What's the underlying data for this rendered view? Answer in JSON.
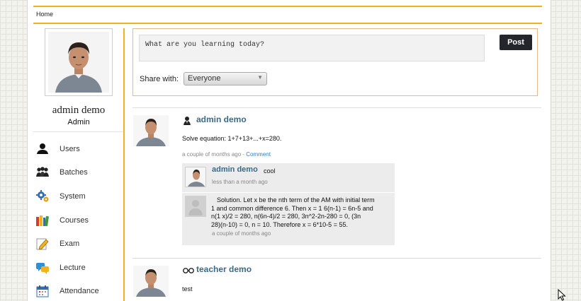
{
  "breadcrumb": {
    "home": "Home"
  },
  "profile": {
    "name": "admin demo",
    "role": "Admin"
  },
  "menu": [
    {
      "label": "Users",
      "icon": "users-icon"
    },
    {
      "label": "Batches",
      "icon": "batches-icon"
    },
    {
      "label": "System",
      "icon": "system-gear-icon"
    },
    {
      "label": "Courses",
      "icon": "courses-books-icon"
    },
    {
      "label": "Exam",
      "icon": "exam-pencil-icon"
    },
    {
      "label": "Lecture",
      "icon": "lecture-chat-icon"
    },
    {
      "label": "Attendance",
      "icon": "attendance-calendar-icon"
    }
  ],
  "composer": {
    "placeholder": "What are you learning today?",
    "post_label": "Post",
    "share_label": "Share with:",
    "share_value": "Everyone"
  },
  "posts": [
    {
      "author": "admin demo",
      "role_icon": "admin-badge-icon",
      "text": "Solve equation: 1+7+13+...+x=280.",
      "time": "a couple of months ago",
      "separator": " - ",
      "comment_link": "Comment",
      "comments": [
        {
          "author": "admin demo",
          "text": "cool",
          "time": "less than a month ago"
        },
        {
          "author": "",
          "text_lines": [
            "Solution. Let x be the nth term of the AM with initial term",
            "1 and common difference 6. Then x = 1 6(n-1) = 6n-5 and",
            "n(1 x)/2 = 280, n(6n-4)/2 = 280, 3n^2-2n-280 = 0, (3n",
            "28)(n-10) = 0, n = 10. Therefore x = 6*10-5 = 55."
          ],
          "time": "a couple of months ago"
        }
      ]
    },
    {
      "author": "teacher demo",
      "role_icon": "teacher-glasses-icon",
      "text": "test"
    }
  ],
  "colors": {
    "accent": "#f0b21d",
    "link": "#3a6a86",
    "button": "#23272c"
  }
}
